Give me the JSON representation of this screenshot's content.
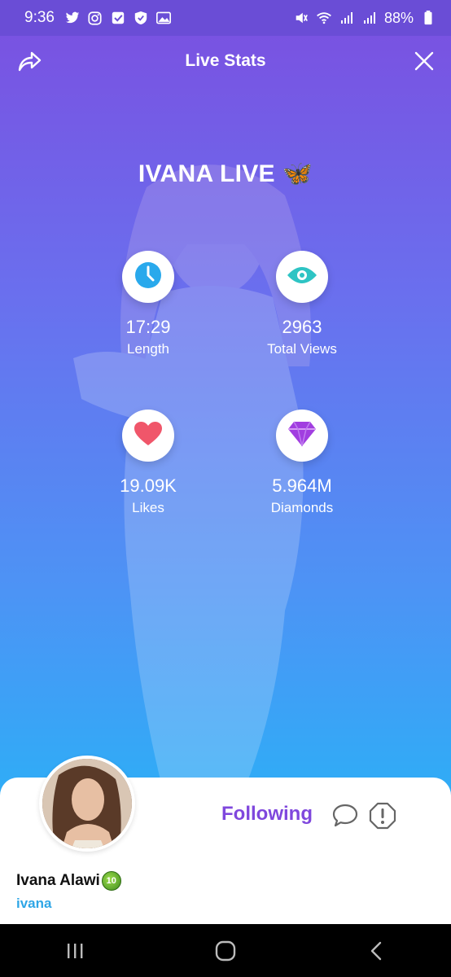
{
  "status_bar": {
    "time": "9:36",
    "battery": "88%",
    "left_icons": [
      "twitter-icon",
      "instagram-icon",
      "check-icon",
      "shield-check-icon",
      "image-icon"
    ],
    "right_icons": [
      "mute-icon",
      "wifi-icon",
      "signal-icon",
      "signal-icon",
      "battery-icon"
    ]
  },
  "header": {
    "title": "Live Stats",
    "share_icon": "share-icon",
    "close_icon": "close-icon"
  },
  "live": {
    "title": "IVANA LIVE 🦋"
  },
  "stats": [
    {
      "value": "17:29",
      "label": "Length",
      "icon": "clock-icon",
      "color": "#29a9ec"
    },
    {
      "value": "2963",
      "label": "Total Views",
      "icon": "eye-icon",
      "color": "#2ec4c4"
    },
    {
      "value": "19.09K",
      "label": "Likes",
      "icon": "heart-icon",
      "color": "#f0566a"
    },
    {
      "value": "5.964M",
      "label": "Diamonds",
      "icon": "diamond-icon",
      "color": "#a13ee0"
    }
  ],
  "profile": {
    "name": "Ivana Alawi",
    "level": "10",
    "handle": "ivana",
    "following_label": "Following",
    "accent": "#7f47dd",
    "handle_color": "#2fa6e6"
  },
  "nav": {
    "buttons": [
      "recents-icon",
      "home-icon",
      "back-icon"
    ]
  }
}
